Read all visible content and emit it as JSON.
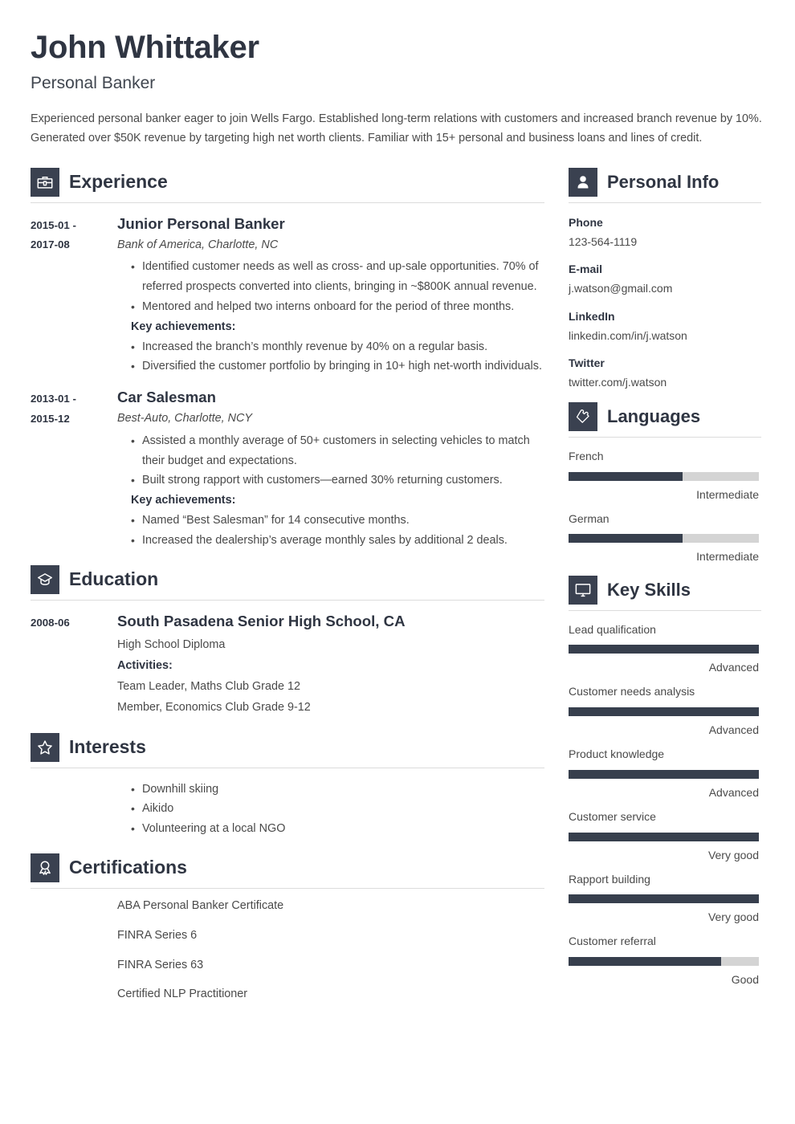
{
  "header": {
    "name": "John Whittaker",
    "job_title": "Personal Banker",
    "summary": "Experienced personal banker eager to join Wells Fargo. Established long-term relations with customers and increased branch revenue by 10%. Generated over $50K revenue by targeting high net worth clients. Familiar with 15+ personal and business loans and lines of credit."
  },
  "colors": {
    "accent_dark": "#3a4150",
    "bar_fill": "#373f4d",
    "bar_track": "#d4d4d4",
    "heading": "#2f3542",
    "body_text": "#4a4a4a",
    "divider": "#dcdcdc"
  },
  "sections": {
    "experience": {
      "title": "Experience",
      "icon": "briefcase-icon",
      "entries": [
        {
          "date": "2015-01 - 2017-08",
          "date_line1": "2015-01 -",
          "date_line2": "2017-08",
          "title": "Junior Personal Banker",
          "subtitle": "Bank of America, Charlotte, NC",
          "bullets": [
            "Identified customer needs as well as cross- and up-sale opportunities. 70% of referred prospects converted into clients, bringing in ~$800K annual revenue.",
            "Mentored and helped two interns onboard for the period of three months."
          ],
          "achievements_label": "Key achievements:",
          "achievements": [
            "Increased the branch’s monthly revenue by 40% on a regular basis.",
            "Diversified the customer portfolio by bringing in 10+ high net-worth individuals."
          ]
        },
        {
          "date": "2013-01 - 2015-12",
          "date_line1": "2013-01 -",
          "date_line2": "2015-12",
          "title": "Car Salesman",
          "subtitle": "Best-Auto, Charlotte, NCY",
          "bullets": [
            "Assisted a monthly average of 50+ customers in selecting vehicles to match their budget and expectations.",
            "Built strong rapport with customers—earned 30% returning customers."
          ],
          "achievements_label": "Key achievements:",
          "achievements": [
            "Named “Best Salesman” for 14 consecutive months.",
            "Increased the dealership’s average monthly sales by additional 2 deals."
          ]
        }
      ]
    },
    "education": {
      "title": "Education",
      "icon": "graduation-cap-icon",
      "entries": [
        {
          "date": "2008-06",
          "title": "South Pasadena Senior High School, CA",
          "degree": "High School Diploma",
          "activities_label": "Activities:",
          "activities": [
            "Team Leader, Maths Club Grade 12",
            "Member, Economics Club Grade 9-12"
          ]
        }
      ]
    },
    "interests": {
      "title": "Interests",
      "icon": "star-icon",
      "items": [
        "Downhill skiing",
        "Aikido",
        "Volunteering at a local NGO"
      ]
    },
    "certifications": {
      "title": "Certifications",
      "icon": "award-ribbon-icon",
      "items": [
        "ABA Personal Banker Certificate",
        "FINRA Series 6",
        "FINRA Series 63",
        "Certified NLP Practitioner"
      ]
    },
    "personal_info": {
      "title": "Personal Info",
      "icon": "person-icon",
      "fields": [
        {
          "label": "Phone",
          "value": "123-564-1119"
        },
        {
          "label": "E-mail",
          "value": "j.watson@gmail.com"
        },
        {
          "label": "LinkedIn",
          "value": "linkedin.com/in/j.watson"
        },
        {
          "label": "Twitter",
          "value": "twitter.com/j.watson"
        }
      ]
    },
    "languages": {
      "title": "Languages",
      "icon": "puzzle-piece-icon",
      "items": [
        {
          "name": "French",
          "level": "Intermediate",
          "percent": 60
        },
        {
          "name": "German",
          "level": "Intermediate",
          "percent": 60
        }
      ]
    },
    "key_skills": {
      "title": "Key Skills",
      "icon": "monitor-icon",
      "items": [
        {
          "name": "Lead qualification",
          "level": "Advanced",
          "percent": 100
        },
        {
          "name": "Customer needs analysis",
          "level": "Advanced",
          "percent": 100
        },
        {
          "name": "Product knowledge",
          "level": "Advanced",
          "percent": 100
        },
        {
          "name": "Customer service",
          "level": "Very good",
          "percent": 100
        },
        {
          "name": "Rapport building",
          "level": "Very good",
          "percent": 100
        },
        {
          "name": "Customer referral",
          "level": "Good",
          "percent": 80
        }
      ]
    }
  }
}
